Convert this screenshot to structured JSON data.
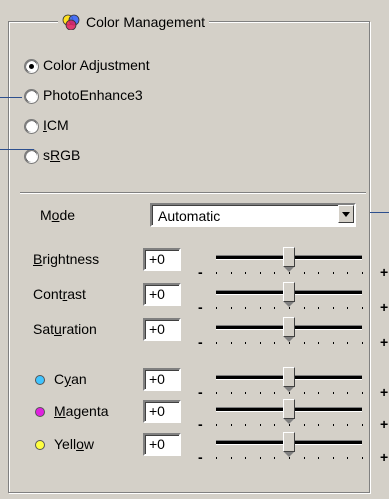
{
  "group": {
    "title": "Color Management",
    "icon": "color-management-icon"
  },
  "radios": [
    {
      "label": "Color Adjustment",
      "checked": true
    },
    {
      "label": "PhotoEnhance3",
      "checked": false
    },
    {
      "label": "ICM",
      "checked": false
    },
    {
      "label": "sRGB",
      "checked": false
    }
  ],
  "mode": {
    "label": "Mode",
    "value": "Automatic"
  },
  "controls": [
    {
      "label": "Brightness",
      "value": "+0",
      "position": 0.5
    },
    {
      "label": "Contrast",
      "value": "+0",
      "position": 0.5
    },
    {
      "label": "Saturation",
      "value": "+0",
      "position": 0.5
    },
    {
      "label": "Cyan",
      "value": "+0",
      "position": 0.5,
      "color": "#40c4ff"
    },
    {
      "label": "Magenta",
      "value": "+0",
      "position": 0.5,
      "color": "#e020e0"
    },
    {
      "label": "Yellow",
      "value": "+0",
      "position": 0.5,
      "color": "#ffff40"
    }
  ],
  "slider_min": "-",
  "slider_max": "+"
}
